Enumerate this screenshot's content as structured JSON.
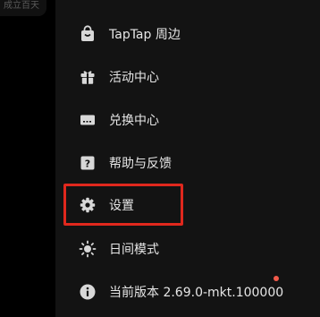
{
  "left_panel": {
    "snippet": "成立百天"
  },
  "menu": {
    "items": [
      {
        "label": "TapTap 周边",
        "icon": "shopping-bag-icon"
      },
      {
        "label": "活动中心",
        "icon": "gift-icon"
      },
      {
        "label": "兑换中心",
        "icon": "redeem-card-icon"
      },
      {
        "label": "帮助与反馈",
        "icon": "help-icon"
      },
      {
        "label": "设置",
        "icon": "gear-icon"
      },
      {
        "label": "日间模式",
        "icon": "sun-icon"
      },
      {
        "label": "当前版本 2.69.0-mkt.100000",
        "icon": "info-icon"
      }
    ]
  },
  "colors": {
    "drawer_bg": "#131313",
    "text": "#e6e6e6",
    "icon": "#d8d8d8",
    "highlight": "#e0281d",
    "update_dot": "#f25a4a"
  }
}
